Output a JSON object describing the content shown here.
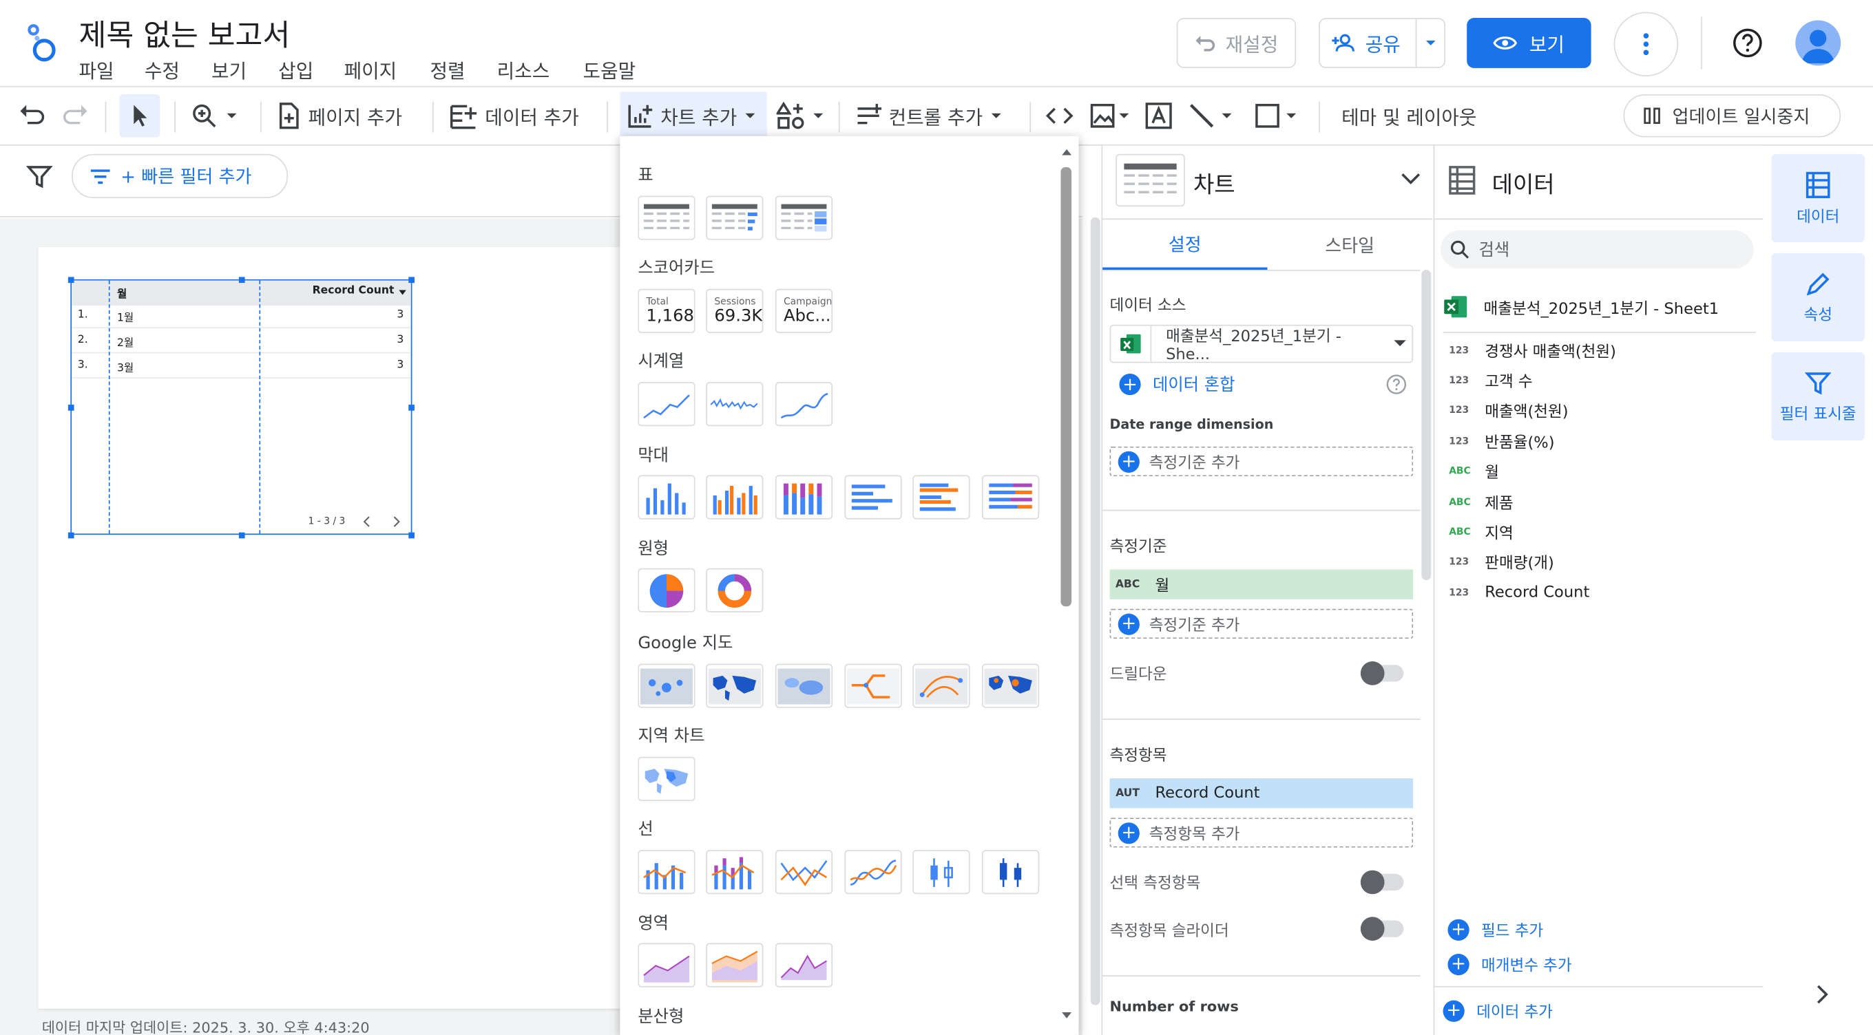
{
  "header": {
    "title": "제목 없는 보고서",
    "menu": [
      "파일",
      "수정",
      "보기",
      "삽입",
      "페이지",
      "정렬",
      "리소스",
      "도움말"
    ],
    "reset_label": "재설정",
    "share_label": "공유",
    "view_label": "보기"
  },
  "toolbar": {
    "add_page": "페이지 추가",
    "add_data": "데이터 추가",
    "add_chart": "차트 추가",
    "add_control": "컨트롤 추가",
    "theme_layout": "테마 및 레이아웃",
    "pause_update": "업데이트 일시중지"
  },
  "filter_bar": {
    "quick_filter": "+ 빠른 필터 추가"
  },
  "canvas": {
    "table": {
      "headers": [
        "월",
        "Record Count"
      ],
      "rows": [
        {
          "idx": "1.",
          "month": "1월",
          "count": "3"
        },
        {
          "idx": "2.",
          "month": "2월",
          "count": "3"
        },
        {
          "idx": "3.",
          "month": "3월",
          "count": "3"
        }
      ],
      "pagination": "1 - 3 / 3"
    },
    "footer": "데이터 마지막 업데이트: 2025. 3. 30. 오후 4:43:20"
  },
  "chart_menu": {
    "sections": [
      "표",
      "스코어카드",
      "시계열",
      "막대",
      "원형",
      "Google 지도",
      "지역 차트",
      "선",
      "영역",
      "분산형"
    ],
    "scorecards": [
      {
        "label": "Total",
        "value": "1,168"
      },
      {
        "label": "Sessions",
        "value": "69.3K"
      },
      {
        "label": "Campaign",
        "value": "Abc..."
      }
    ]
  },
  "chart_panel": {
    "title": "차트",
    "tab_setup": "설정",
    "tab_style": "스타일",
    "data_source_label": "데이터 소스",
    "data_source_value": "매출분석_2025년_1분기 - She...",
    "blend_label": "데이터 혼합",
    "date_range_label": "Date range dimension",
    "add_dimension": "측정기준 추가",
    "dimension_label": "측정기준",
    "dimension_type": "ABC",
    "dimension_value": "월",
    "drilldown_label": "드릴다운",
    "metric_label": "측정항목",
    "metric_type": "AUT",
    "metric_value": "Record Count",
    "add_metric": "측정항목 추가",
    "optional_metrics": "선택 측정항목",
    "metric_slider": "측정항목 슬라이더",
    "rows_label": "Number of rows"
  },
  "data_panel": {
    "title": "데이터",
    "search_placeholder": "검색",
    "source": "매출분석_2025년_1분기 - Sheet1",
    "fields": [
      {
        "type": "123",
        "name": "경쟁사 매출액(천원)"
      },
      {
        "type": "123",
        "name": "고객 수"
      },
      {
        "type": "123",
        "name": "매출액(천원)"
      },
      {
        "type": "123",
        "name": "반품율(%)"
      },
      {
        "type": "ABC",
        "name": "월"
      },
      {
        "type": "ABC",
        "name": "제품"
      },
      {
        "type": "ABC",
        "name": "지역"
      },
      {
        "type": "123",
        "name": "판매량(개)"
      },
      {
        "type": "123",
        "name": "Record Count"
      }
    ],
    "add_field": "필드 추가",
    "add_param": "매개변수 추가",
    "add_data": "데이터 추가"
  },
  "rail": {
    "data": "데이터",
    "properties": "속성",
    "filter": "필터 표시줄"
  },
  "colors": {
    "accent": "#1a73e8",
    "dimension_chip": "#ceead6",
    "metric_chip": "#c2e1f9",
    "excel": "#1d6f42"
  }
}
